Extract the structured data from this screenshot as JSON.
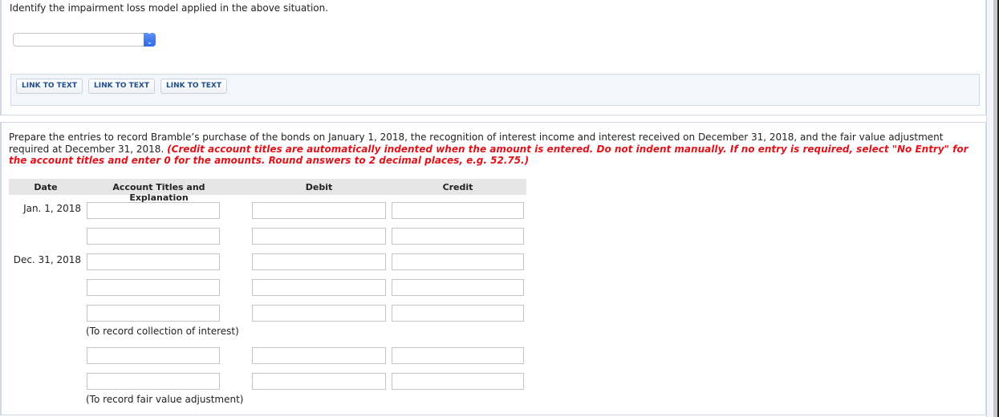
{
  "question": {
    "label": "Identify the impairment loss model applied in the above situation.",
    "select": {
      "value": "",
      "icon": "up-down-chevron-icon"
    }
  },
  "links": [
    {
      "label": "LINK TO TEXT"
    },
    {
      "label": "LINK TO TEXT"
    },
    {
      "label": "LINK TO TEXT"
    }
  ],
  "instructions": {
    "text": "Prepare the entries to record Bramble’s purchase of the bonds on January 1, 2018, the recognition of interest income and interest received on December 31, 2018, and the fair value adjustment required at December 31, 2018.",
    "note": "(Credit account titles are automatically indented when the amount is entered. Do not indent manually. If no entry is required, select \"No Entry\" for the account titles and enter 0 for the amounts. Round answers to 2 decimal places, e.g. 52.75.)"
  },
  "journal": {
    "headers": {
      "date": "Date",
      "account": "Account Titles and Explanation",
      "debit": "Debit",
      "credit": "Credit"
    },
    "rows": [
      {
        "date": "Jan. 1, 2018",
        "account": "",
        "debit": "",
        "credit": ""
      },
      {
        "date": "",
        "account": "",
        "debit": "",
        "credit": ""
      },
      {
        "date": "Dec. 31, 2018",
        "account": "",
        "debit": "",
        "credit": ""
      },
      {
        "date": "",
        "account": "",
        "debit": "",
        "credit": ""
      },
      {
        "date": "",
        "account": "",
        "debit": "",
        "credit": ""
      },
      {
        "date": "",
        "account": "",
        "debit": "",
        "credit": ""
      },
      {
        "date": "",
        "account": "",
        "debit": "",
        "credit": ""
      }
    ],
    "notes": {
      "interest": "(To record collection of interest)",
      "fair_value": "(To record fair value adjustment)"
    }
  }
}
